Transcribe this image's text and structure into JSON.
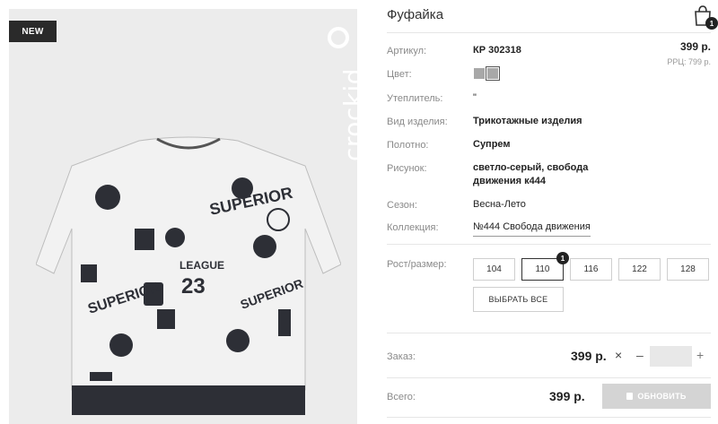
{
  "product": {
    "title": "Фуфайка",
    "badge": "NEW",
    "brand": "crockid"
  },
  "cart": {
    "count": "1",
    "icon": "shopping-bag-icon"
  },
  "price": {
    "value": "399 р.",
    "rrp": "РРЦ: 799 р."
  },
  "specs": {
    "article_label": "Артикул:",
    "article_value": "КР 302318",
    "color_label": "Цвет:",
    "insulation_label": "Утеплитель:",
    "insulation_value": "\"",
    "type_label": "Вид изделия:",
    "type_value": "Трикотажные изделия",
    "fabric_label": "Полотно:",
    "fabric_value": "Супрем",
    "pattern_label": "Рисунок:",
    "pattern_line1": "светло-серый, свобода",
    "pattern_line2": "движения к444",
    "season_label": "Сезон:",
    "season_value": "Весна-Лето",
    "collection_label": "Коллекция:",
    "collection_value": "№444 Свобода движения"
  },
  "colors": [
    "#a8a8a8",
    "#a8a8a8"
  ],
  "sizes": {
    "label": "Рост/размер:",
    "options": [
      "104",
      "110",
      "116",
      "122",
      "128"
    ],
    "selected": "110",
    "selected_count": "1",
    "select_all": "ВЫБРАТЬ ВСЕ"
  },
  "order": {
    "label": "Заказ:",
    "price": "399 р.",
    "remove": "×",
    "minus": "–",
    "plus": "+",
    "qty_value": ""
  },
  "total": {
    "label": "Всего:",
    "price": "399 р.",
    "update_button": "ОБНОВИТЬ"
  }
}
